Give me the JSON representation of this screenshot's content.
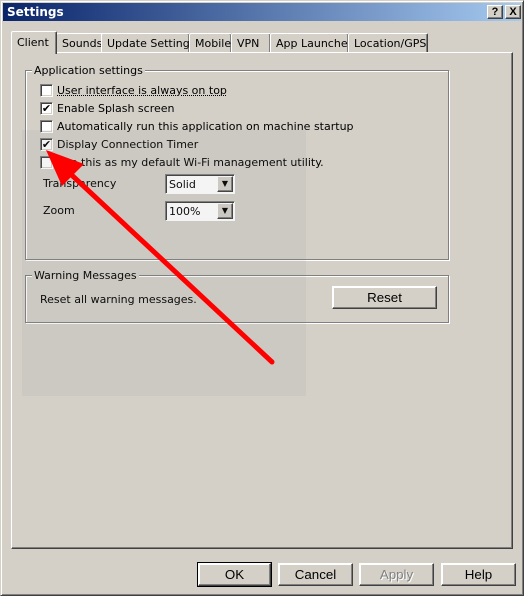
{
  "window": {
    "title": "Settings",
    "help_label": "?",
    "close_label": "X"
  },
  "tabs": [
    {
      "label": "Client"
    },
    {
      "label": "Sounds"
    },
    {
      "label": "Update Settings"
    },
    {
      "label": "Mobile"
    },
    {
      "label": "VPN"
    },
    {
      "label": "App Launcher"
    },
    {
      "label": "Location/GPS"
    }
  ],
  "app_settings": {
    "legend": "Application settings",
    "options": [
      {
        "label": "User interface is always on top",
        "checked": false
      },
      {
        "label": "Enable Splash screen",
        "checked": true
      },
      {
        "label": "Automatically run this application on machine startup",
        "checked": false
      },
      {
        "label": "Display Connection Timer",
        "checked": true
      },
      {
        "label": "Use this as my default Wi-Fi management utility.",
        "checked": false
      }
    ],
    "transparency": {
      "label": "Transparency",
      "value": "Solid"
    },
    "zoom": {
      "label": "Zoom",
      "value": "100%"
    }
  },
  "warnings": {
    "legend": "Warning Messages",
    "text": "Reset all warning messages.",
    "reset_label": "Reset"
  },
  "footer": {
    "ok_label": "OK",
    "cancel_label": "Cancel",
    "apply_label": "Apply",
    "help_label": "Help"
  },
  "check_mark": "✔",
  "dropdown_glyph": "▼",
  "annotation_color": "#ff0000"
}
